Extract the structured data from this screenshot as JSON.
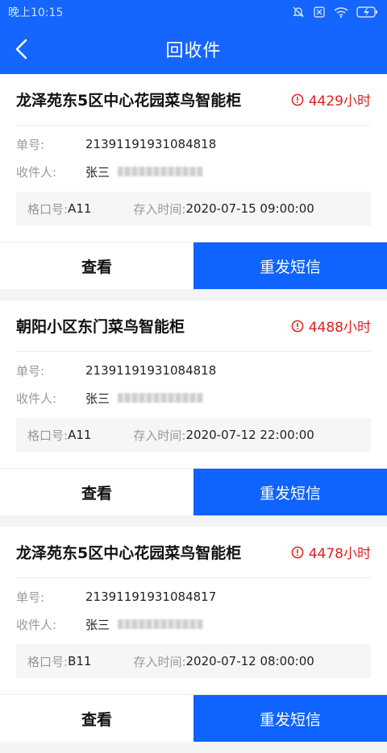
{
  "status_bar": {
    "time": "晚上10:15",
    "icons": [
      "mute-bell-icon",
      "sim-off-icon",
      "wifi-icon",
      "battery-charging-icon"
    ]
  },
  "navbar": {
    "title": "回收件",
    "back_icon": "chevron-left-icon"
  },
  "cards": [
    {
      "locker": "龙泽苑东5区中心花园菜鸟智能柜",
      "hours": "4429小时",
      "order_label": "单号:",
      "order_no": "21391191931084818",
      "recipient_label": "收件人:",
      "recipient_name": "张三",
      "slot_label": "格口号:",
      "slot": "A11",
      "time_label": "存入时间:",
      "time": "2020-07-15 09:00:00",
      "view_label": "查看",
      "resend_label": "重发短信"
    },
    {
      "locker": "朝阳小区东门菜鸟智能柜",
      "hours": "4488小时",
      "order_label": "单号:",
      "order_no": "21391191931084818",
      "recipient_label": "收件人:",
      "recipient_name": "张三",
      "slot_label": "格口号:",
      "slot": "A11",
      "time_label": "存入时间:",
      "time": "2020-07-12 22:00:00",
      "view_label": "查看",
      "resend_label": "重发短信"
    },
    {
      "locker": "龙泽苑东5区中心花园菜鸟智能柜",
      "hours": "4478小时",
      "order_label": "单号:",
      "order_no": "21391191931084817",
      "recipient_label": "收件人:",
      "recipient_name": "张三",
      "slot_label": "格口号:",
      "slot": "B11",
      "time_label": "存入时间:",
      "time": "2020-07-12 08:00:00",
      "view_label": "查看",
      "resend_label": "重发短信"
    }
  ],
  "colors": {
    "primary": "#1565ff",
    "alert": "#e02020"
  }
}
